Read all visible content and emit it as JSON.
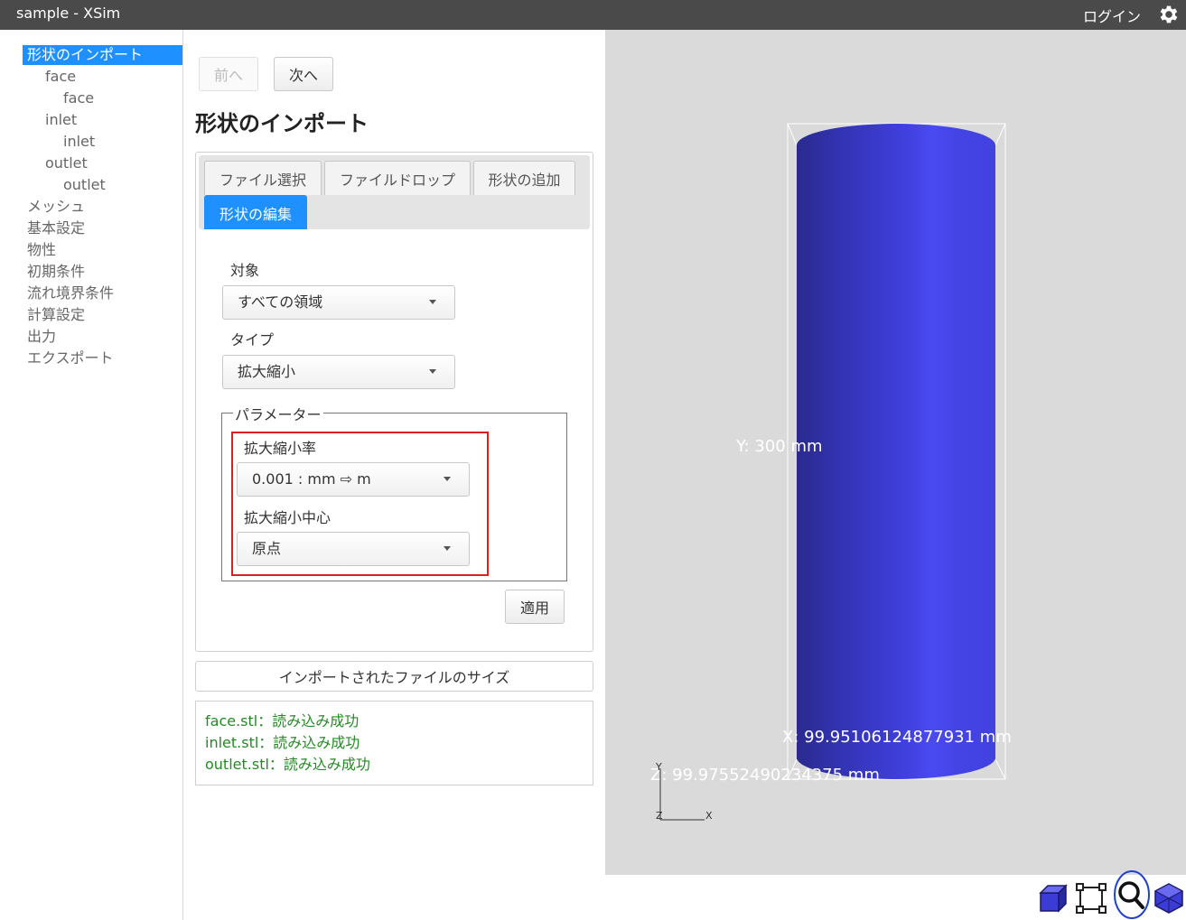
{
  "app": {
    "title": "sample - XSim",
    "login": "ログイン"
  },
  "sidebar": {
    "items": [
      {
        "label": "形状のインポート",
        "level": 0,
        "active": true
      },
      {
        "label": "face",
        "level": 1
      },
      {
        "label": "face",
        "level": 2
      },
      {
        "label": "inlet",
        "level": 1
      },
      {
        "label": "inlet",
        "level": 2
      },
      {
        "label": "outlet",
        "level": 1
      },
      {
        "label": "outlet",
        "level": 2
      },
      {
        "label": "メッシュ",
        "level": 0
      },
      {
        "label": "基本設定",
        "level": 0
      },
      {
        "label": "物性",
        "level": 0
      },
      {
        "label": "初期条件",
        "level": 0
      },
      {
        "label": "流れ境界条件",
        "level": 0
      },
      {
        "label": "計算設定",
        "level": 0
      },
      {
        "label": "出力",
        "level": 0
      },
      {
        "label": "エクスポート",
        "level": 0
      }
    ]
  },
  "nav": {
    "prev": "前へ",
    "next": "次へ"
  },
  "page": {
    "title": "形状のインポート"
  },
  "tabs": [
    {
      "label": "ファイル選択",
      "active": false
    },
    {
      "label": "ファイルドロップ",
      "active": false
    },
    {
      "label": "形状の追加",
      "active": false
    },
    {
      "label": "形状の編集",
      "active": true
    }
  ],
  "form": {
    "target_label": "対象",
    "target_value": "すべての領域",
    "type_label": "タイプ",
    "type_value": "拡大縮小",
    "params_legend": "パラメーター",
    "scale_label": "拡大縮小率",
    "scale_value": "0.001 : mm ⇨ m",
    "center_label": "拡大縮小中心",
    "center_value": "原点",
    "apply": "適用"
  },
  "imported": {
    "size_button": "インポートされたファイルのサイズ",
    "log": [
      "face.stl：読み込み成功",
      "inlet.stl：読み込み成功",
      "outlet.stl：読み込み成功"
    ],
    "log_color": "#228b22"
  },
  "viewport": {
    "y_dim": "Y: 300 mm",
    "x_dim": "X: 99.95106124877931 mm",
    "z_dim": "Z: 99.97552490234375 mm",
    "axis_y": "Y",
    "axis_x": "X",
    "axis_z": "Z",
    "shape_color": "#3a3acf",
    "background": "#dadada"
  },
  "toolbar": {
    "icons": [
      "cube-view-icon",
      "fit-bounds-icon",
      "zoom-icon",
      "polyhedron-icon"
    ],
    "active": "zoom-icon"
  },
  "colors": {
    "accent": "#1e90ff",
    "highlight": "#e02020",
    "titlebar": "#4a4a4a"
  }
}
